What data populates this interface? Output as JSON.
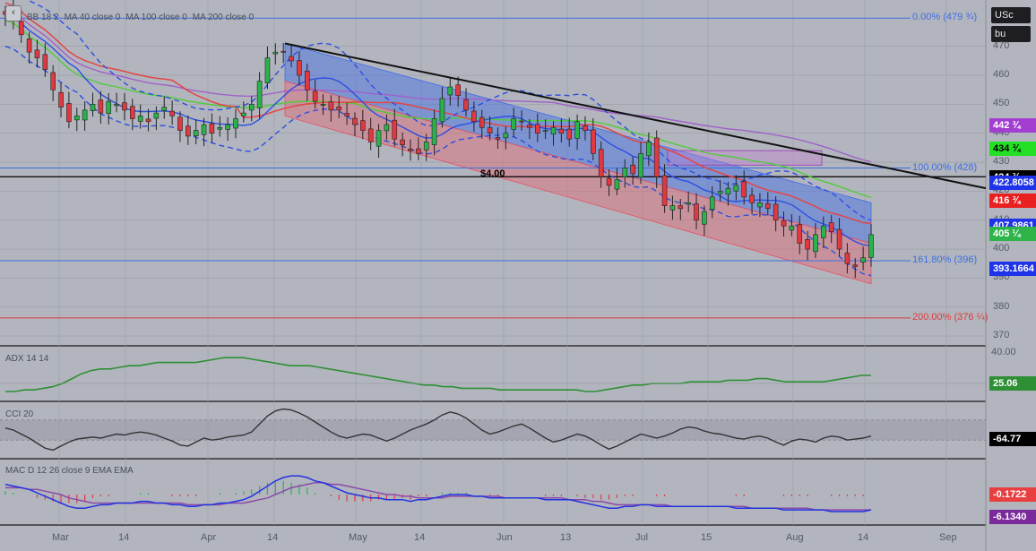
{
  "toolbar": {
    "symbol": "USc",
    "mode": "bu",
    "nav_glyph": "‹"
  },
  "legends": {
    "main": [
      "BB 18 2",
      "MA 40 close 0",
      "MA 100 close 0",
      "MA 200 close 0"
    ],
    "adx": "ADX 14 14",
    "cci": "CCI 20",
    "macd": "MAC D 12 26 close 9 EMA EMA"
  },
  "colors": {
    "bg": "#b2b5be",
    "up": "#29b34a",
    "down": "#e2383f",
    "bb": "#2d4fe0",
    "ma40": "#e44545",
    "ma100": "#4fcc3a",
    "ma200": "#a061c8",
    "trend": "#111111",
    "fib": "#3d6fe0",
    "fib200": "#e03a3a",
    "adx": "#2f8f35",
    "cci": "#333333",
    "macd": "#2233e0",
    "signal": "#8a4aa8"
  },
  "chart_data": {
    "type": "candlestick",
    "price_axis": {
      "ticks": [
        470,
        460,
        450,
        440,
        430,
        420,
        410,
        400,
        390,
        380,
        370
      ],
      "range": [
        366,
        486
      ]
    },
    "time_axis": {
      "labels": [
        "Mar",
        "14",
        "Apr",
        "14",
        "May",
        "14",
        "Jun",
        "13",
        "Jul",
        "15",
        "Aug",
        "14",
        "Sep"
      ]
    },
    "fib_levels": [
      {
        "label": "0.00% (479 ¾)",
        "value": 479.75
      },
      {
        "label": "100.00% (428)",
        "value": 428
      },
      {
        "label": "161.80% (396)",
        "value": 396
      },
      {
        "label": "200.00% (376 ¼)",
        "value": 376.25
      }
    ],
    "annotation": {
      "text": "$4.00",
      "value": 425
    },
    "price_tags": [
      {
        "text": "442 ¾",
        "value": 442.75,
        "bg": "#a33fd0",
        "fg": "#ffffff"
      },
      {
        "text": "434 ¾",
        "value": 434.75,
        "bg": "#24e024",
        "fg": "#000000"
      },
      {
        "text": "424 ¾",
        "value": 424.75,
        "bg": "#000000",
        "fg": "#ffffff"
      },
      {
        "text": "422.8058",
        "value": 422.8,
        "bg": "#1f34e8",
        "fg": "#ffffff"
      },
      {
        "text": "416 ¾",
        "value": 416.75,
        "bg": "#e82020",
        "fg": "#ffffff"
      },
      {
        "text": "407.9861",
        "value": 407.99,
        "bg": "#1f34e8",
        "fg": "#ffffff"
      },
      {
        "text": "405 ¼",
        "value": 405.25,
        "bg": "#2fb44a",
        "fg": "#ffffff"
      },
      {
        "text": "393.1664",
        "value": 393.17,
        "bg": "#1f34e8",
        "fg": "#ffffff"
      }
    ],
    "closes": [
      481,
      479,
      474,
      468,
      466,
      462,
      455,
      449,
      444,
      446,
      448,
      450,
      447,
      451,
      450,
      448,
      445,
      446,
      444,
      447,
      449,
      446,
      441,
      439,
      441,
      443,
      440,
      442,
      443,
      445,
      447,
      450,
      458,
      466,
      468,
      468,
      465,
      460,
      455,
      451,
      450,
      448,
      448,
      446,
      443,
      441,
      437,
      441,
      443,
      438,
      436,
      434,
      433,
      437,
      445,
      452,
      456,
      453,
      448,
      444,
      442,
      440,
      438,
      440,
      445,
      444,
      442,
      440,
      441,
      442,
      440,
      438,
      444,
      441,
      433,
      425,
      422,
      424,
      428,
      426,
      433,
      437,
      425,
      415,
      415,
      414,
      416,
      410,
      413,
      418,
      420,
      421,
      422,
      418,
      416,
      416,
      414,
      410,
      408,
      408,
      402,
      400,
      405,
      408,
      406,
      400,
      395,
      394,
      397,
      405
    ],
    "adx": {
      "label": "25.06",
      "tick": "40.00",
      "values": [
        20,
        20,
        21,
        21,
        22,
        23,
        25,
        28,
        31,
        33,
        34,
        34,
        35,
        36,
        36,
        37,
        38,
        38,
        38,
        38,
        38,
        39,
        40,
        41,
        41,
        41,
        40,
        39,
        38,
        37,
        36,
        36,
        36,
        35,
        34,
        33,
        32,
        31,
        30,
        29,
        28,
        27,
        26,
        25,
        24,
        24,
        23,
        23,
        22,
        22,
        22,
        22,
        21,
        21,
        21,
        21,
        21,
        21,
        21,
        21,
        21,
        20,
        20,
        21,
        22,
        23,
        24,
        24,
        25,
        25,
        25,
        25,
        26,
        26,
        26,
        26,
        27,
        27,
        27,
        28,
        28,
        27,
        26,
        26,
        26,
        26,
        26,
        27,
        28,
        29,
        30,
        30
      ]
    },
    "cci": {
      "label": "-64.77",
      "values": [
        20,
        0,
        -40,
        -80,
        -130,
        -180,
        -200,
        -160,
        -120,
        -90,
        -80,
        -70,
        -80,
        -60,
        -40,
        -50,
        -30,
        -20,
        -30,
        -50,
        -80,
        -110,
        -150,
        -160,
        -120,
        -80,
        -100,
        -90,
        -70,
        -60,
        -50,
        -20,
        60,
        140,
        190,
        210,
        200,
        170,
        130,
        80,
        30,
        -20,
        -60,
        -80,
        -60,
        -40,
        -50,
        -80,
        -110,
        -80,
        -40,
        0,
        30,
        60,
        100,
        150,
        180,
        160,
        120,
        60,
        0,
        -40,
        -20,
        10,
        40,
        60,
        20,
        -30,
        -80,
        -120,
        -100,
        -70,
        -40,
        -60,
        -100,
        -150,
        -190,
        -160,
        -120,
        -80,
        -40,
        -60,
        -80,
        -60,
        -30,
        10,
        30,
        20,
        -10,
        -30,
        -40,
        -60,
        -80,
        -90,
        -70,
        -60,
        -80,
        -120,
        -150,
        -110,
        -90,
        -100,
        -120,
        -80,
        -60,
        -70,
        -100,
        -90,
        -80,
        -60
      ]
    },
    "macd": {
      "label_macd": "-0.1722",
      "label_signal": "-6.1340",
      "macd": [
        6,
        5,
        4,
        3,
        1,
        -1,
        -3,
        -5,
        -7,
        -8,
        -8,
        -7,
        -6,
        -6,
        -5,
        -5,
        -5,
        -4,
        -4,
        -5,
        -5,
        -6,
        -6,
        -7,
        -7,
        -6,
        -6,
        -5,
        -5,
        -4,
        -3,
        -1,
        2,
        5,
        8,
        10,
        11,
        11,
        10,
        8,
        7,
        5,
        3,
        1,
        0,
        -1,
        -2,
        -2,
        -3,
        -3,
        -3,
        -4,
        -3,
        -3,
        -2,
        -1,
        0,
        0,
        0,
        -1,
        -1,
        -2,
        -2,
        -2,
        -2,
        -2,
        -2,
        -2,
        -3,
        -3,
        -3,
        -3,
        -4,
        -5,
        -6,
        -7,
        -8,
        -8,
        -7,
        -7,
        -6,
        -6,
        -7,
        -7,
        -7,
        -7,
        -7,
        -7,
        -7,
        -7,
        -7,
        -7,
        -8,
        -8,
        -8,
        -8,
        -8,
        -8,
        -9,
        -9,
        -9,
        -9,
        -9,
        -9,
        -10,
        -10,
        -10,
        -10,
        -10,
        -9
      ],
      "signal": [
        4,
        4,
        4,
        3,
        3,
        2,
        1,
        0,
        -2,
        -3,
        -4,
        -5,
        -5,
        -5,
        -5,
        -5,
        -5,
        -5,
        -5,
        -5,
        -5,
        -5,
        -5,
        -6,
        -6,
        -6,
        -6,
        -6,
        -5,
        -5,
        -5,
        -4,
        -3,
        -2,
        0,
        2,
        4,
        5,
        6,
        7,
        7,
        6,
        6,
        5,
        4,
        3,
        2,
        1,
        0,
        0,
        -1,
        -1,
        -2,
        -2,
        -2,
        -2,
        -1,
        -1,
        -1,
        -1,
        -1,
        -1,
        -1,
        -2,
        -2,
        -2,
        -2,
        -2,
        -2,
        -2,
        -2,
        -3,
        -3,
        -3,
        -4,
        -4,
        -5,
        -6,
        -6,
        -6,
        -6,
        -6,
        -6,
        -6,
        -7,
        -7,
        -7,
        -7,
        -7,
        -7,
        -7,
        -7,
        -7,
        -7,
        -8,
        -8,
        -8,
        -8,
        -8,
        -8,
        -8,
        -8,
        -9,
        -9,
        -9,
        -9,
        -9,
        -9,
        -9,
        -9
      ]
    }
  }
}
